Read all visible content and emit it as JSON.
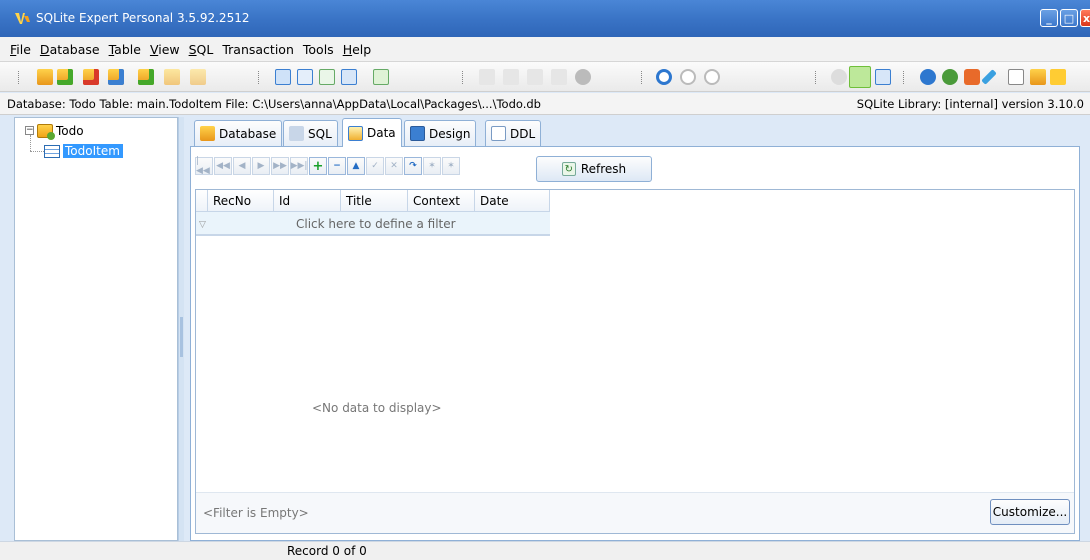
{
  "window": {
    "title": "SQLite Expert Personal 3.5.92.2512"
  },
  "menu": [
    {
      "label": "File",
      "underline": "F",
      "rest": "ile"
    },
    {
      "label": "Database",
      "underline": "D",
      "rest": "atabase"
    },
    {
      "label": "Table",
      "underline": "T",
      "rest": "able"
    },
    {
      "label": "View",
      "underline": "V",
      "rest": "iew"
    },
    {
      "label": "SQL",
      "underline": "S",
      "rest": "QL"
    },
    {
      "label": "Transaction",
      "underline": "Tr",
      "rest": "ansaction"
    },
    {
      "label": "Tools",
      "underline": "To",
      "rest": "ols"
    },
    {
      "label": "Help",
      "underline": "H",
      "rest": "elp"
    }
  ],
  "infobar": {
    "left": "Database: Todo   Table: main.TodoItem   File: C:\\Users\\anna\\AppData\\Local\\Packages\\...\\Todo.db",
    "right": "SQLite Library: [internal] version 3.10.0"
  },
  "tree": {
    "database": "Todo",
    "table": "TodoItem"
  },
  "tabs": [
    {
      "label": "Database",
      "icon": "database-icon",
      "color": "#e9a21c"
    },
    {
      "label": "SQL",
      "icon": "sql-icon",
      "color": "#7a9bc4"
    },
    {
      "label": "Data",
      "icon": "data-icon",
      "color": "#f0b030"
    },
    {
      "label": "Design",
      "icon": "design-icon",
      "color": "#3b7fd1"
    },
    {
      "label": "DDL",
      "icon": "ddl-icon",
      "color": "#9fb9d9"
    }
  ],
  "active_tab": "Data",
  "refresh_label": "Refresh",
  "grid": {
    "columns": [
      "RecNo",
      "Id",
      "Title",
      "Context",
      "Date"
    ],
    "filter_prompt": "Click here to define a filter",
    "empty_text": "<No data to display>",
    "filter_status": "<Filter is Empty>",
    "customize_label": "Customize..."
  },
  "status": {
    "record": "Record 0 of 0"
  }
}
